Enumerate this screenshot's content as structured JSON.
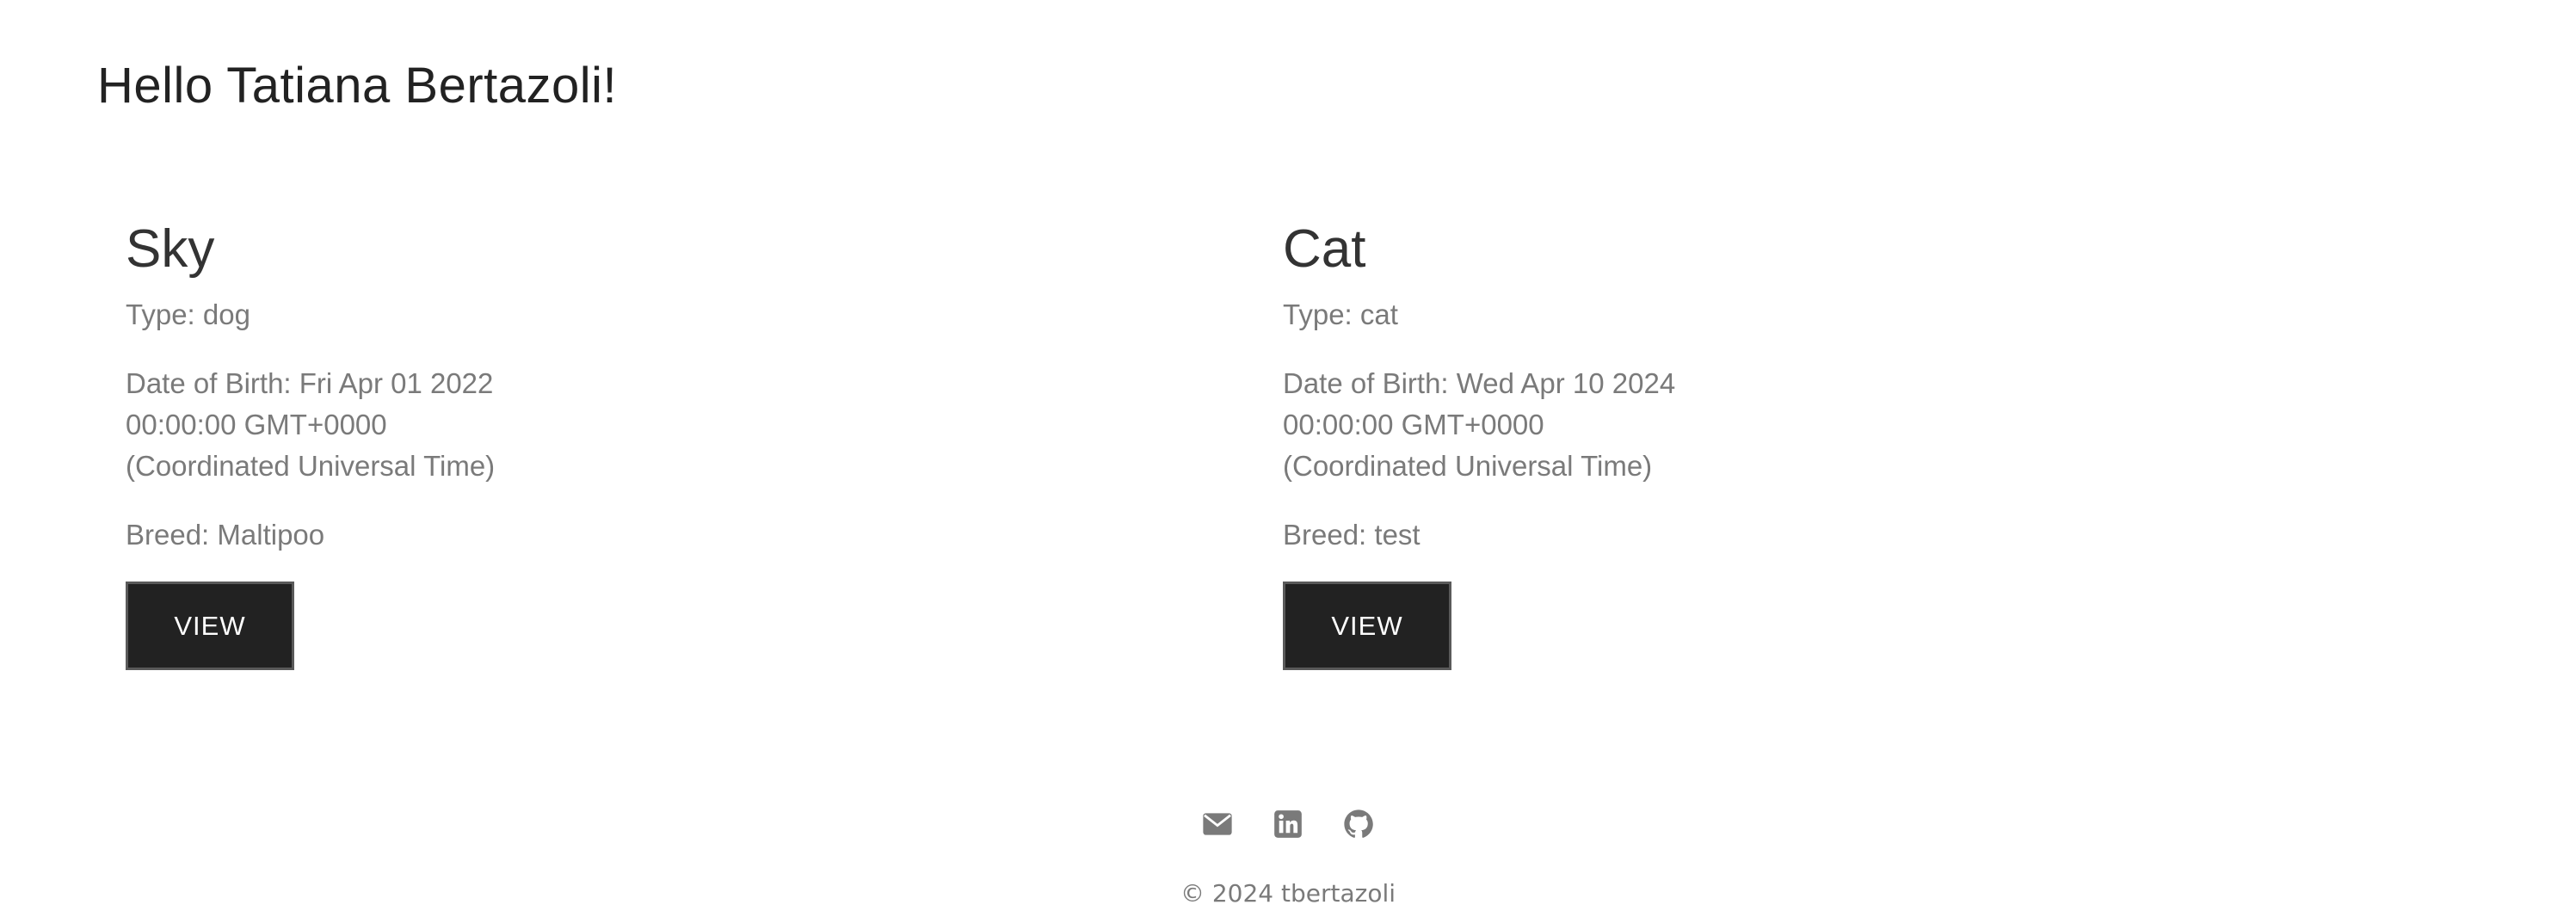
{
  "greeting": "Hello Tatiana Bertazoli!",
  "pets": [
    {
      "name": "Sky",
      "type_line": "Type: dog",
      "dob_line_1": "Date of Birth: Fri Apr 01 2022",
      "dob_line_2": "00:00:00 GMT+0000",
      "dob_line_3": "(Coordinated Universal Time)",
      "breed_line": "Breed: Maltipoo",
      "view_label": "VIEW"
    },
    {
      "name": "Cat",
      "type_line": "Type: cat",
      "dob_line_1": "Date of Birth: Wed Apr 10 2024",
      "dob_line_2": "00:00:00 GMT+0000",
      "dob_line_3": "(Coordinated Universal Time)",
      "breed_line": "Breed: test",
      "view_label": "VIEW"
    }
  ],
  "footer": {
    "icons": [
      "envelope-icon",
      "linkedin-icon",
      "github-icon"
    ],
    "copyright": "© 2024 tbertazoli"
  },
  "colors": {
    "text_dark": "#222222",
    "text_muted": "#7a7a7a",
    "button_bg": "#222222",
    "button_border": "#5a5a5a",
    "icon": "#7a7a7a"
  }
}
